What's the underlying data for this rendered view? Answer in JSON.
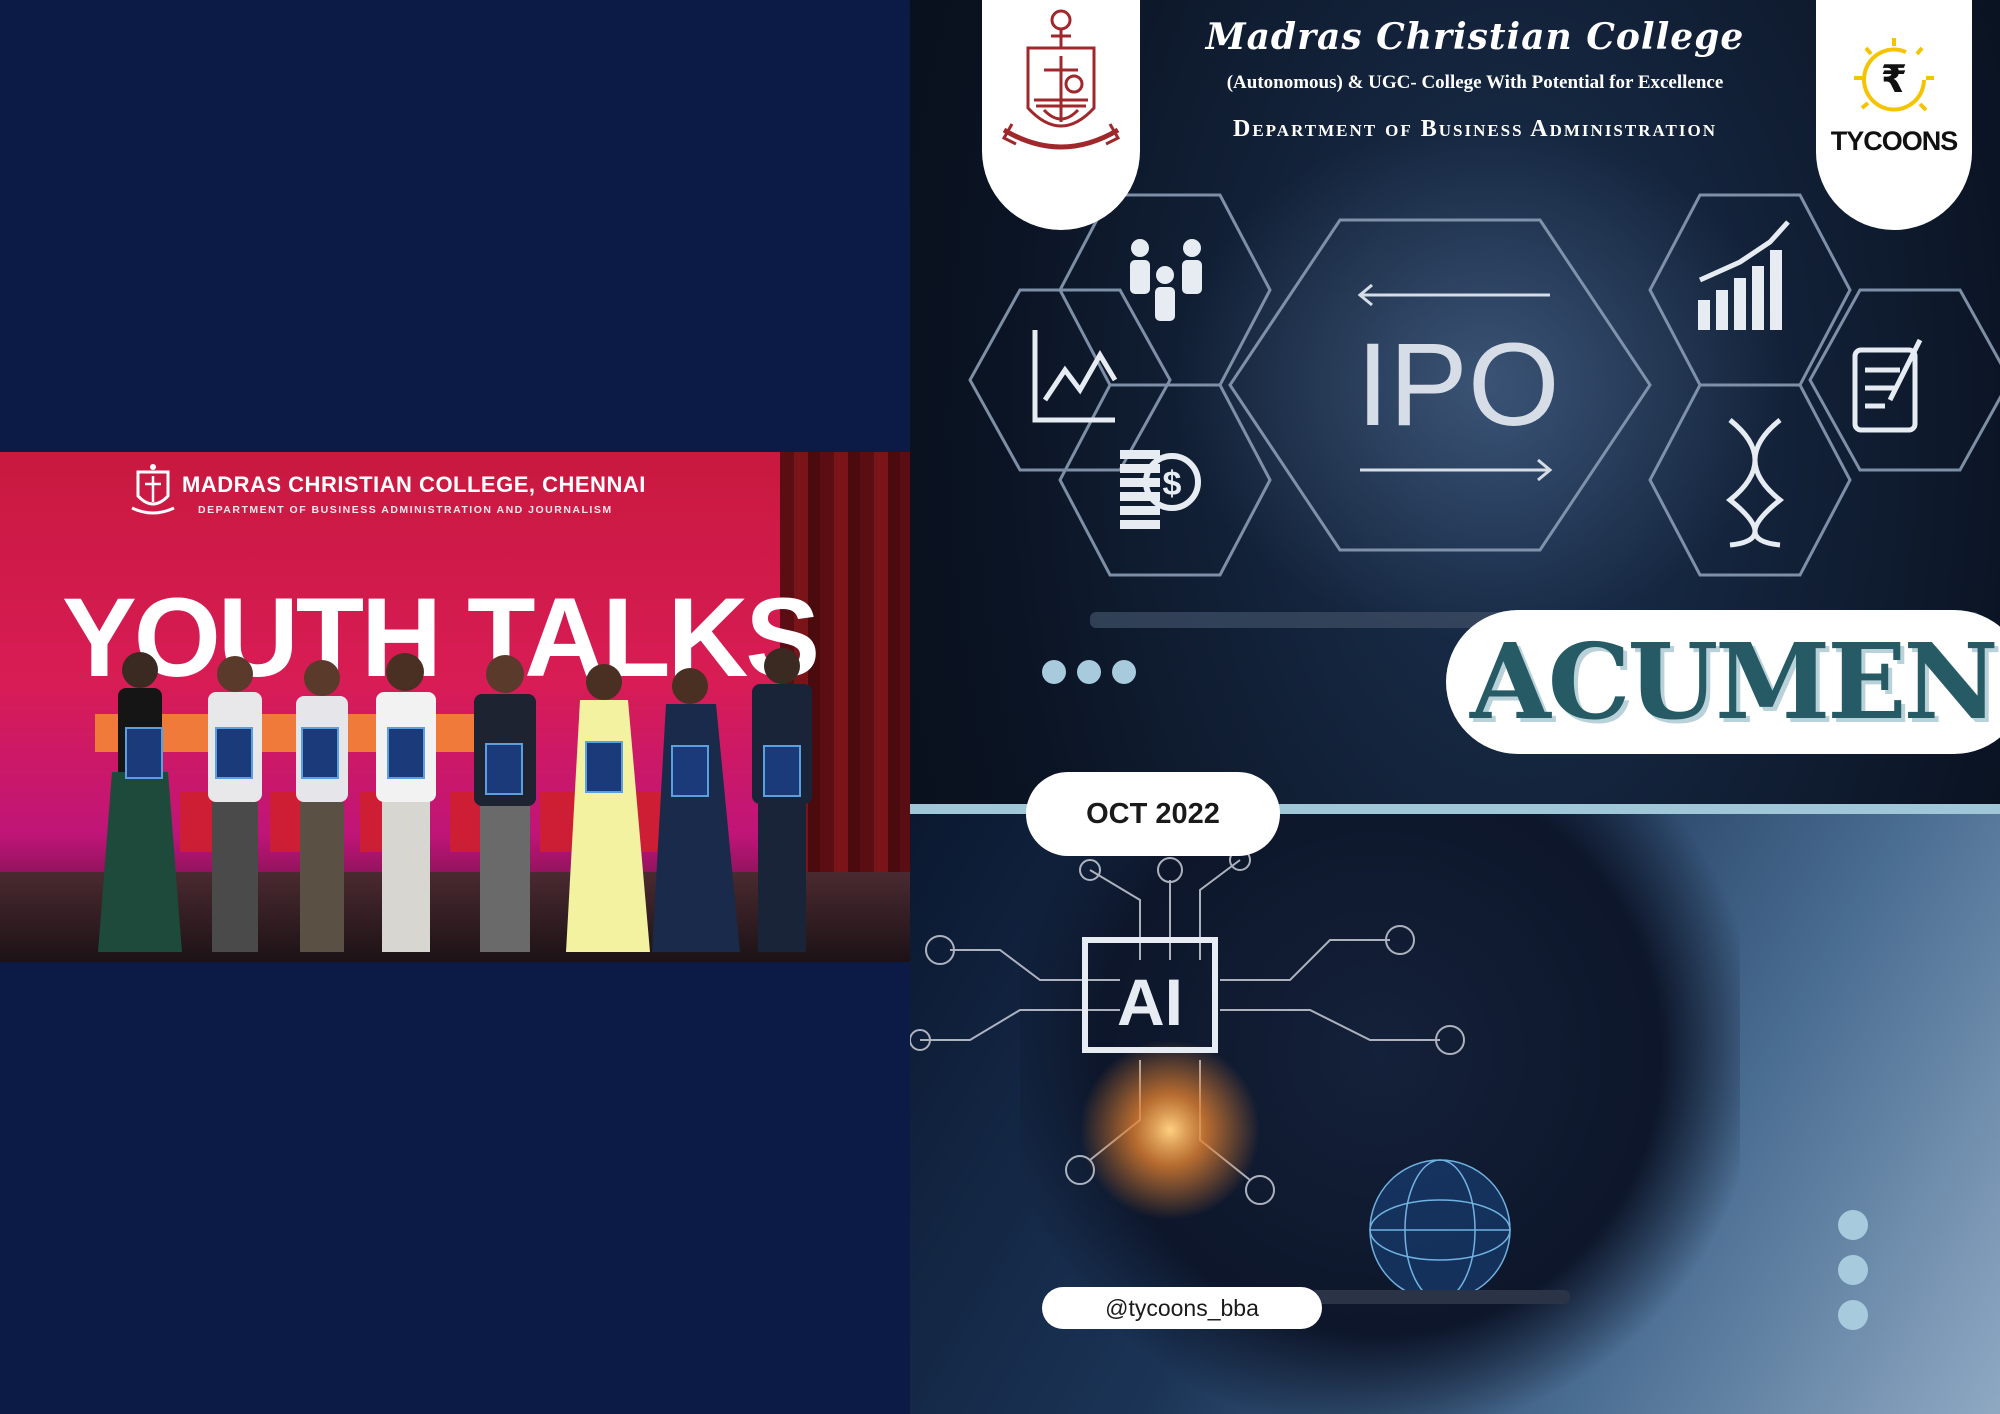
{
  "left_page": {
    "banner": {
      "college": "MADRAS CHRISTIAN COLLEGE, CHENNAI",
      "department": "DEPARTMENT OF BUSINESS ADMINISTRATION AND JOURNALISM",
      "event_title": "YOUTH TALKS"
    }
  },
  "right_page": {
    "header": {
      "college_name": "Madras Christian College",
      "subtitle": "(Autonomous) & UGC- College With Potential for Excellence",
      "department": "Department of Business Administration"
    },
    "club": {
      "name": "TYCOONS",
      "symbol": "₹"
    },
    "graphics": {
      "ipo_label": "IPO",
      "ai_label": "AI"
    },
    "magazine_title": "ACUMEN",
    "issue_date": "OCT 2022",
    "social_handle": "@tycoons_bba",
    "colors": {
      "navy": "#0c1b45",
      "teal_title": "#265b66",
      "accent_blue": "#a7cbdc",
      "tycoons_yellow": "#f5c400"
    }
  }
}
